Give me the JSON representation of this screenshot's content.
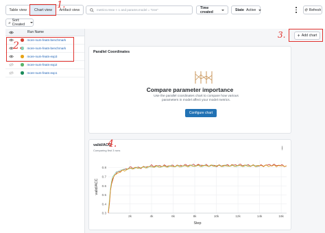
{
  "toolbar": {
    "tabs": [
      {
        "label": "Table view"
      },
      {
        "label": "Chart view",
        "selected": true
      },
      {
        "label": "Artifact view"
      }
    ],
    "search_placeholder": "metrics.rmse < 1 and params.model = \"tree\"",
    "time_filter": "Time created",
    "state_label": "State",
    "state_value": "Active",
    "refresh_label": "Refresh",
    "sort_label": "Sort: Created"
  },
  "annotations": [
    "1.",
    "2.",
    "3.",
    "4."
  ],
  "runs": {
    "header": "Run Name",
    "items": [
      {
        "name": "more-num-feats-benchmark",
        "color": "#d23f31",
        "visible": true
      },
      {
        "name": "more-num-feats-benchmark",
        "color": "#8bd1b8",
        "visible": true
      },
      {
        "name": "more-num-feats-exp3",
        "color": "#e6a317",
        "visible": true
      },
      {
        "name": "more-num-feats-exp2",
        "color": "#59b36b",
        "visible": false
      },
      {
        "name": "more-num-feats-exp1",
        "color": "#1a8a5a",
        "visible": false
      }
    ]
  },
  "add_chart_label": "Add chart",
  "parallel": {
    "title": "Parallel Coordinates",
    "heading": "Compare parameter importance",
    "description": "Use the parallel coordinates chart to compare how various parameters in model affect your model metrics.",
    "button": "Configure chart"
  },
  "acc_card": {
    "title": "valid/ACC",
    "subtitle": "Comparing first 3 runs"
  },
  "chart_data": {
    "type": "line",
    "title": "valid/ACC",
    "xlabel": "Step",
    "ylabel": "valid/ACC",
    "xlim": [
      0,
      16500
    ],
    "ylim": [
      0.3,
      0.88
    ],
    "xticks": [
      2000,
      4000,
      6000,
      8000,
      10000,
      12000,
      14000,
      16000
    ],
    "xtick_labels": [
      "2k",
      "4k",
      "6k",
      "8k",
      "10k",
      "12k",
      "14k",
      "16k"
    ],
    "yticks": [
      0.3,
      0.4,
      0.5,
      0.6,
      0.7,
      0.8
    ],
    "ytick_labels": [
      "0.3",
      "0.4",
      "0.5",
      "0.6",
      "0.7",
      "0.8"
    ],
    "series": [
      {
        "color": "#c6352c",
        "x": [
          0,
          100,
          200,
          300,
          400,
          500,
          600,
          800,
          1000,
          1500,
          2000,
          3000,
          4000,
          6000,
          8000,
          10000,
          12000,
          14000,
          15000,
          16500
        ],
        "y": [
          0.3,
          0.4,
          0.55,
          0.62,
          0.66,
          0.7,
          0.72,
          0.74,
          0.76,
          0.78,
          0.8,
          0.8,
          0.82,
          0.82,
          0.83,
          0.82,
          0.83,
          0.82,
          0.83,
          0.82
        ]
      },
      {
        "color": "#8bd1b8",
        "x": [
          0,
          100,
          200,
          300,
          400,
          600,
          1000,
          2000,
          4000,
          8000,
          12000,
          14000
        ],
        "y": [
          0.32,
          0.45,
          0.58,
          0.65,
          0.7,
          0.73,
          0.77,
          0.79,
          0.81,
          0.82,
          0.82,
          0.82
        ]
      },
      {
        "color": "#d69a1a",
        "x": [
          0,
          100,
          200,
          300,
          400,
          600,
          1000,
          2000,
          4000,
          8000,
          12000,
          16500
        ],
        "y": [
          0.31,
          0.42,
          0.56,
          0.63,
          0.68,
          0.72,
          0.75,
          0.79,
          0.81,
          0.82,
          0.82,
          0.82
        ]
      }
    ],
    "grid": true
  }
}
